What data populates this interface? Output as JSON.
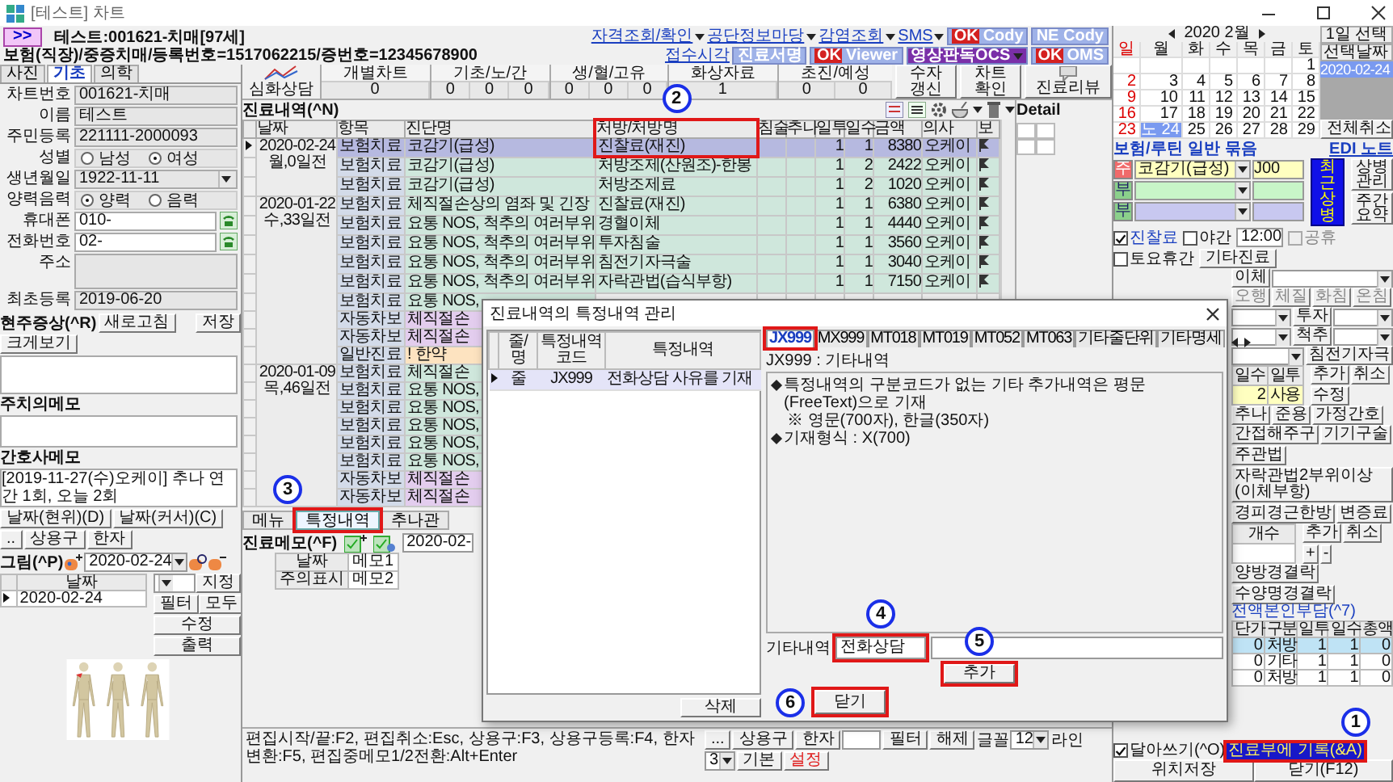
{
  "window": {
    "title": "[테스트] 차트"
  },
  "header": {
    "toggle": ">>",
    "patient": "테스트:001621-치매[97세]",
    "insurance": "보험(직장)/중증치매/등록번호=1517062215/증번호=12345678900"
  },
  "toolbar": [
    [
      {
        "kind": "menu",
        "label": "자격조회/확인"
      },
      {
        "kind": "menu",
        "label": "공단정보마당"
      },
      {
        "kind": "menu",
        "label": "감염조회"
      },
      {
        "kind": "menu",
        "label": "SMS"
      },
      {
        "kind": "ok-badge",
        "badge": "OK",
        "label": "Cody"
      },
      {
        "kind": "badge",
        "label": "NE Cody"
      }
    ],
    [
      {
        "kind": "link",
        "label": "접수시각"
      },
      {
        "kind": "badge",
        "label": "진료서명"
      },
      {
        "kind": "ok-badge",
        "badge": "OK",
        "label": "Viewer"
      },
      {
        "kind": "menu-badge",
        "label": "영상판독OCS"
      },
      {
        "kind": "ok-badge",
        "badge": "OK",
        "label": "OMS"
      }
    ]
  ],
  "patient_tabs": [
    {
      "label": "사진",
      "selected": false
    },
    {
      "label": "기초",
      "selected": true
    },
    {
      "label": "의학",
      "selected": false
    }
  ],
  "patient_fields": [
    {
      "kind": "text",
      "label": "차트번호",
      "value": "001621-치매"
    },
    {
      "kind": "text",
      "label": "이름",
      "value": "테스트"
    },
    {
      "kind": "text",
      "label": "주민등록",
      "value": "221111-2000093"
    },
    {
      "kind": "radio",
      "label": "성별",
      "options": [
        {
          "label": "남성",
          "selected": false
        },
        {
          "label": "여성",
          "selected": true
        }
      ]
    },
    {
      "kind": "select",
      "label": "생년월일",
      "value": "1922-11-11"
    },
    {
      "kind": "radio",
      "label": "양력음력",
      "options": [
        {
          "label": "양력",
          "selected": true
        },
        {
          "label": "음력",
          "selected": false
        }
      ]
    },
    {
      "kind": "phone",
      "label": "휴대폰",
      "value": "010-"
    },
    {
      "kind": "phone",
      "label": "전화번호",
      "value": "02-"
    },
    {
      "kind": "area",
      "label": "주소"
    },
    {
      "kind": "text",
      "label": "최초등록",
      "value": "2019-06-20"
    }
  ],
  "symptoms": {
    "title": "현주증상(^R)",
    "buttons": [
      "새로고침",
      "저장",
      "크게보기"
    ]
  },
  "doctor_memo": {
    "title": "주치의메모"
  },
  "nurse_memo": {
    "title": "간호사메모",
    "text": "[2019-11-27(수)오케이] 추나 연간 1회, 오늘 2회"
  },
  "memo_buttons": [
    "날짜(현위)(D)",
    "날짜(커서)(C)",
    "..",
    "상용구",
    "한자"
  ],
  "drawing": {
    "title": "그림(^P)",
    "date": "2020-02-24",
    "column": "날짜",
    "rows": [
      {
        "date": "2020-02-24",
        "selected": true
      }
    ],
    "buttons": [
      "지정",
      "필터",
      "모두",
      "수정",
      "출력"
    ]
  },
  "summary": {
    "analysis": "심화상담",
    "cells": [
      {
        "label": "개별차트",
        "values": [
          "0"
        ]
      },
      {
        "label": "기초/노/간",
        "values": [
          "0",
          "0",
          "0"
        ]
      },
      {
        "label": "생/혈/고유",
        "values": [
          "0",
          "0",
          "0"
        ]
      },
      {
        "label": "화상자료",
        "values": [
          "1"
        ]
      },
      {
        "label": "초진/예성",
        "values": [
          "0",
          "0"
        ]
      }
    ],
    "buttons": [
      {
        "kind": "text",
        "label": "수자 갱신"
      },
      {
        "kind": "text",
        "label": "차트 확인"
      },
      {
        "kind": "icon",
        "label": "진료리뷰"
      }
    ]
  },
  "history": {
    "title": "진료내역(^N)",
    "columns": [
      {
        "label": "날짜"
      },
      {
        "label": "항목"
      },
      {
        "label": "진단명"
      },
      {
        "label": "처방/처방명",
        "callout": {
          "number": "2"
        }
      },
      {
        "label": "침술"
      },
      {
        "label": "추나"
      },
      {
        "label": "일투"
      },
      {
        "label": "일수"
      },
      {
        "label": "금액"
      },
      {
        "label": "의사"
      },
      {
        "label": "보"
      }
    ],
    "rows": [
      {
        "date": "2020-02-24",
        "ago": "월,0일전",
        "kind": "insurance",
        "item": "보험치료",
        "diagnosis": "코감기(급성)",
        "order": "진찰료(재진)",
        "day_dose": "1",
        "days": "1",
        "amount": "8380",
        "doctor": "오케이",
        "selected": true
      },
      {
        "kind": "insurance",
        "item": "보험치료",
        "diagnosis": "코감기(급성)",
        "order": "처방조제(산원조)-한봉",
        "day_dose": "1",
        "days": "2",
        "amount": "2422",
        "doctor": "오케이",
        "selected": false
      },
      {
        "kind": "insurance",
        "item": "보험치료",
        "diagnosis": "코감기(급성)",
        "order": "처방조제료",
        "day_dose": "1",
        "days": "2",
        "amount": "1020",
        "doctor": "오케이",
        "selected": false
      },
      {
        "date": "2020-01-22",
        "ago": "수,33일전",
        "kind": "insurance",
        "item": "보험치료",
        "diagnosis": "체직절손상의 염좌 및 긴장",
        "order": "진찰료(재진)",
        "day_dose": "1",
        "days": "1",
        "amount": "6380",
        "doctor": "오케이",
        "selected": false
      },
      {
        "kind": "insurance",
        "item": "보험치료",
        "diagnosis": "요통 NOS, 척추의 여러부위",
        "order": "경혈이체",
        "day_dose": "1",
        "days": "1",
        "amount": "4440",
        "doctor": "오케이",
        "selected": false
      },
      {
        "kind": "insurance",
        "item": "보험치료",
        "diagnosis": "요통 NOS, 척추의 여러부위",
        "order": "투자침술",
        "day_dose": "1",
        "days": "1",
        "amount": "3560",
        "doctor": "오케이",
        "selected": false
      },
      {
        "kind": "insurance",
        "item": "보험치료",
        "diagnosis": "요통 NOS, 척추의 여러부위",
        "order": "침전기자극술",
        "day_dose": "1",
        "days": "1",
        "amount": "3040",
        "doctor": "오케이",
        "selected": false
      },
      {
        "kind": "insurance",
        "item": "보험치료",
        "diagnosis": "요통 NOS, 척추의 여러부위",
        "order": "자락관법(습식부항)",
        "day_dose": "1",
        "days": "1",
        "amount": "7150",
        "doctor": "오케이",
        "selected": false
      },
      {
        "kind": "insurance",
        "item": "보험치료",
        "diagnosis": "요통 NOS,",
        "selected": false
      },
      {
        "kind": "auto",
        "item": "자동차보",
        "diagnosis": "체직절손",
        "selected": false
      },
      {
        "kind": "auto",
        "item": "자동차보",
        "diagnosis": "체직절손",
        "selected": false
      },
      {
        "kind": "general",
        "item": "일반진료",
        "diagnosis": "! 한약",
        "selected": false
      },
      {
        "date": "2020-01-09",
        "ago": "목,46일전",
        "kind": "insurance",
        "item": "보험치료",
        "diagnosis": "체직절손",
        "selected": false
      },
      {
        "kind": "insurance",
        "item": "보험치료",
        "diagnosis": "요통 NOS,",
        "selected": false
      },
      {
        "kind": "insurance",
        "item": "보험치료",
        "diagnosis": "요통 NOS,",
        "selected": false
      },
      {
        "kind": "insurance",
        "item": "보험치료",
        "diagnosis": "요통 NOS,",
        "selected": false
      },
      {
        "kind": "insurance",
        "item": "보험치료",
        "diagnosis": "요통 NOS,",
        "selected": false
      },
      {
        "kind": "insurance",
        "item": "보험치료",
        "diagnosis": "요통 NOS,",
        "selected": false
      },
      {
        "kind": "auto",
        "item": "자동차보",
        "diagnosis": "체직절손",
        "selected": false
      },
      {
        "kind": "auto",
        "item": "자동차보",
        "diagnosis": "체직절손",
        "selected": false
      }
    ]
  },
  "detail": {
    "title": "Detail"
  },
  "history_tabs": [
    {
      "label": "메뉴",
      "selected": false
    },
    {
      "label": "특정내역",
      "selected": true,
      "callout": {
        "number": "3"
      }
    },
    {
      "label": "추나관",
      "selected": false
    }
  ],
  "memo": {
    "title": "진료메모(^F)",
    "date": "2020-02-",
    "rows": [
      {
        "label": "날짜",
        "value": "메모1"
      },
      {
        "label": "주의표시",
        "value": "메모2"
      }
    ]
  },
  "status_bar": {
    "hint": "편집시작/끝:F2, 편집취소:Esc, 상용구:F3, 상용구등록:F4, 한자변환:F5, 편집중메모1/2전환:Alt+Enter",
    "buttons": [
      "...",
      "상용구",
      "한자"
    ],
    "filter": "필터",
    "clear": "해제",
    "font_label": "글꼴",
    "font_size": "12",
    "line_label": "라인",
    "line_count": "3",
    "default": "기본",
    "settings": "설정"
  },
  "calendar": {
    "title": "2020 2월",
    "weekdays": [
      "일",
      "월",
      "화",
      "수",
      "목",
      "금",
      "토"
    ],
    "weeks": [
      [
        {
          "day": "1",
          "selected": false
        }
      ],
      [
        {
          "day": "2",
          "selected": false
        },
        {
          "day": "3",
          "selected": false
        },
        {
          "day": "4",
          "selected": false
        },
        {
          "day": "5",
          "selected": false
        },
        {
          "day": "6",
          "selected": false
        },
        {
          "day": "7",
          "selected": false
        },
        {
          "day": "8",
          "selected": false
        }
      ],
      [
        {
          "day": "9",
          "selected": false
        },
        {
          "day": "10",
          "selected": false
        },
        {
          "day": "11",
          "selected": false
        },
        {
          "day": "12",
          "selected": false
        },
        {
          "day": "13",
          "selected": false
        },
        {
          "day": "14",
          "selected": false
        },
        {
          "day": "15",
          "selected": false
        }
      ],
      [
        {
          "day": "16",
          "selected": false
        },
        {
          "day": "17",
          "selected": false
        },
        {
          "day": "18",
          "selected": false
        },
        {
          "day": "19",
          "selected": false
        },
        {
          "day": "20",
          "selected": false
        },
        {
          "day": "21",
          "selected": false
        },
        {
          "day": "22",
          "selected": false
        }
      ],
      [
        {
          "day": "23",
          "selected": false
        },
        {
          "day": "24",
          "selected": true,
          "tag": "노"
        },
        {
          "day": "25",
          "selected": false
        },
        {
          "day": "26",
          "selected": false
        },
        {
          "day": "27",
          "selected": false
        },
        {
          "day": "28",
          "selected": false
        },
        {
          "day": "29",
          "selected": false
        }
      ]
    ]
  },
  "date_list": {
    "action": "1일 선택",
    "header": "선택날짜",
    "dates": [
      {
        "label": "2020-02-24",
        "selected": true
      }
    ],
    "clear": "전체취소"
  },
  "order_tabs": [
    "보험/루틴",
    "일반",
    "묶음"
  ],
  "edi_note": "EDI 노트",
  "diagnoses": [
    {
      "kind": "main",
      "tag": "주",
      "name": "코감기(급성)",
      "code": "J00",
      "color": "#ffffc0"
    },
    {
      "kind": "sub",
      "tag": "부",
      "color": "#c8f5c8"
    },
    {
      "kind": "sub",
      "tag": "부",
      "color": "#c8c8f0"
    }
  ],
  "diagnosis_buttons": {
    "recent": "최근상병",
    "manage": "상병관리",
    "weekly": "주간요약"
  },
  "visit_options": [
    {
      "kind": "check",
      "label": "진찰료",
      "checked": true,
      "disabled": false
    },
    {
      "kind": "check",
      "label": "야간",
      "checked": false,
      "disabled": false
    },
    {
      "kind": "time",
      "value": "12:00"
    },
    {
      "kind": "check",
      "label": "공휴",
      "checked": false,
      "disabled": true
    },
    {
      "kind": "check",
      "label": "토요휴간",
      "checked": false,
      "disabled": false
    },
    {
      "kind": "button",
      "label": "기타진료"
    }
  ],
  "treatment": {
    "transfer": "이체",
    "methods": [
      "오행",
      "체질",
      "화침",
      "온침"
    ],
    "selects": [
      "투자",
      "척추"
    ],
    "stim": "침전기자극",
    "dose_columns": [
      "일수",
      "일투"
    ],
    "dose_rows": [
      [
        "2",
        "사용"
      ]
    ],
    "dose_buttons": [
      "추가",
      "취소",
      "수정"
    ],
    "tabs": [
      "추나",
      "준용",
      "가정간호"
    ],
    "procedures": [
      "간접해주구",
      "기기구술",
      "주관법",
      "자락관법2부위이상(이체부항)",
      "경피경근한방",
      "변증료"
    ],
    "code_column": "개수",
    "code_buttons": [
      "추가",
      "취소",
      "+",
      "-"
    ],
    "links": [
      "양방경결락",
      "수양명경결락"
    ],
    "charge": "전액본인부담(^7)",
    "fee_columns": [
      "단가",
      "구분",
      "일투",
      "일수",
      "총액"
    ],
    "fee_rows": [
      {
        "cells": [
          "0",
          "처방",
          "1",
          "1",
          "0"
        ],
        "selected": true
      },
      {
        "cells": [
          "0",
          "기타",
          "1",
          "1",
          "0"
        ],
        "selected": false
      },
      {
        "cells": [
          "0",
          "처방",
          "1",
          "1",
          "0"
        ],
        "selected": false
      }
    ]
  },
  "write_through": {
    "label": "달아쓰기(^O)",
    "checked": true
  },
  "record_button": {
    "label": "진료부에 기록(&A)",
    "callout": {
      "number": "1"
    }
  },
  "footer_buttons": [
    "위치저장",
    "닫기(F12)"
  ],
  "dialog": {
    "title": "진료내역의 특정내역 관리",
    "columns": [
      "줄/명",
      "특정내역코드",
      "특정내역"
    ],
    "rows": [
      {
        "cells": [
          "줄",
          "JX999",
          "전화상담 사유를 기재"
        ],
        "selected": true
      }
    ],
    "delete": "삭제",
    "tabs": [
      {
        "label": "JX999",
        "selected": true,
        "highlighted": true
      },
      {
        "label": "MX999",
        "selected": false,
        "highlighted": false
      },
      {
        "label": "MT018",
        "selected": false,
        "highlighted": false
      },
      {
        "label": "MT019",
        "selected": false,
        "highlighted": false
      },
      {
        "label": "MT052",
        "selected": false,
        "highlighted": false
      },
      {
        "label": "MT063",
        "selected": false,
        "highlighted": false
      },
      {
        "label": "기타줄단위",
        "selected": false,
        "highlighted": false
      },
      {
        "label": "기타명세",
        "selected": false,
        "highlighted": false
      }
    ],
    "section": "JX999 : 기타내역",
    "notes": [
      {
        "kind": "bullet",
        "text": "특정내역의 구분코드가 없는 기타 추가내역은 평문(FreeText)으로 기재"
      },
      {
        "kind": "note",
        "text": "※ 영문(700자), 한글(350자)"
      },
      {
        "kind": "bullet",
        "text": "기재형식 : X(700)"
      }
    ],
    "input_label": "기타내역",
    "input_value": "전화상담",
    "input_callout": {
      "number": "4"
    },
    "add": {
      "label": "추가",
      "callout": {
        "number": "5"
      }
    },
    "close": {
      "label": "닫기",
      "callout": {
        "number": "6"
      }
    }
  }
}
